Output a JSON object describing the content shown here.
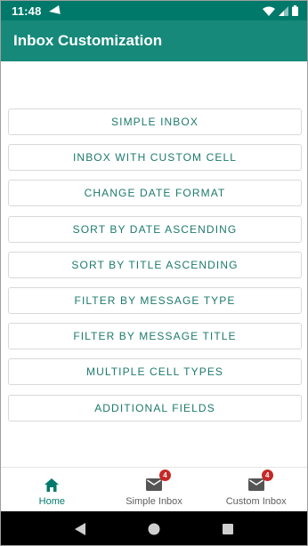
{
  "status_bar": {
    "time": "11:48",
    "icons": [
      "navigation-icon",
      "wifi-icon",
      "signal-icon",
      "battery-icon"
    ]
  },
  "app_bar": {
    "title": "Inbox Customization"
  },
  "menu": {
    "buttons": [
      "SIMPLE INBOX",
      "INBOX WITH CUSTOM CELL",
      "CHANGE DATE FORMAT",
      "SORT BY DATE ASCENDING",
      "SORT BY TITLE ASCENDING",
      "FILTER BY MESSAGE TYPE",
      "FILTER BY MESSAGE TITLE",
      "MULTIPLE CELL TYPES",
      "ADDITIONAL FIELDS"
    ]
  },
  "bottom_nav": {
    "items": [
      {
        "label": "Home",
        "icon": "home-icon",
        "active": true
      },
      {
        "label": "Simple Inbox",
        "icon": "mail-icon",
        "badge": "4"
      },
      {
        "label": "Custom Inbox",
        "icon": "mail-icon",
        "badge": "4"
      }
    ]
  },
  "colors": {
    "status_bar": "#00796b",
    "app_bar": "#16897a",
    "button_text": "#1d7a6d",
    "active_nav": "#00796b",
    "badge": "#c62828"
  }
}
